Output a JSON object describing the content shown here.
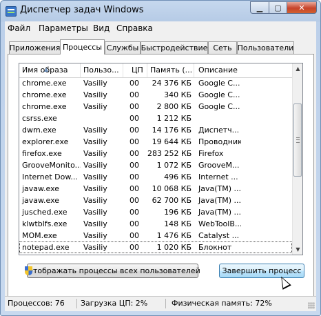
{
  "window": {
    "title": "Диспетчер задач Windows"
  },
  "menu": [
    "Файл",
    "Параметры",
    "Вид",
    "Справка"
  ],
  "tabs": [
    "Приложения",
    "Процессы",
    "Службы",
    "Быстродействие",
    "Сеть",
    "Пользователи"
  ],
  "active_tab": "Процессы",
  "columns": {
    "name": "Имя образа",
    "user": "Пользо...",
    "cpu": "ЦП",
    "mem": "Память (...",
    "desc": "Описание"
  },
  "rows": [
    [
      "chrome.exe",
      "Vasiliy",
      "00",
      "24 376 КБ",
      "Google C..."
    ],
    [
      "chrome.exe",
      "Vasiliy",
      "00",
      "340 КБ",
      "Google C..."
    ],
    [
      "chrome.exe",
      "Vasiliy",
      "00",
      "2 800 КБ",
      "Google C..."
    ],
    [
      "csrss.exe",
      "",
      "00",
      "1 212 КБ",
      ""
    ],
    [
      "dwm.exe",
      "Vasiliy",
      "00",
      "14 176 КБ",
      "Диспетч..."
    ],
    [
      "explorer.exe",
      "Vasiliy",
      "00",
      "19 644 КБ",
      "Проводник"
    ],
    [
      "firefox.exe",
      "Vasiliy",
      "00",
      "283 252 КБ",
      "Firefox"
    ],
    [
      "GrooveMonito...",
      "Vasiliy",
      "00",
      "1 072 КБ",
      "GrooveM..."
    ],
    [
      "Internet Dow...",
      "Vasiliy",
      "00",
      "496 КБ",
      "Internet ..."
    ],
    [
      "javaw.exe",
      "Vasiliy",
      "00",
      "10 068 КБ",
      "Java(TM) ..."
    ],
    [
      "javaw.exe",
      "Vasiliy",
      "00",
      "62 700 КБ",
      "Java(TM) ..."
    ],
    [
      "jusched.exe",
      "Vasiliy",
      "00",
      "196 КБ",
      "Java(TM) ..."
    ],
    [
      "klwtblfs.exe",
      "Vasiliy",
      "00",
      "148 КБ",
      "WebToolB..."
    ],
    [
      "MOM.exe",
      "Vasiliy",
      "00",
      "1 476 КБ",
      "Catalyst ..."
    ],
    [
      "notepad.exe",
      "Vasiliy",
      "00",
      "1 020 КБ",
      "Блокнот"
    ]
  ],
  "selected_row": 14,
  "buttons": {
    "show_all": "Отображать процессы всех пользователей",
    "end_process": "Завершить процесс"
  },
  "status": {
    "processes": "Процессов: 76",
    "cpu": "Загрузка ЦП: 2%",
    "memory": "Физическая память: 72%"
  },
  "icons": {
    "shield": "uac-shield-icon",
    "cursor": "mouse-cursor-icon"
  }
}
